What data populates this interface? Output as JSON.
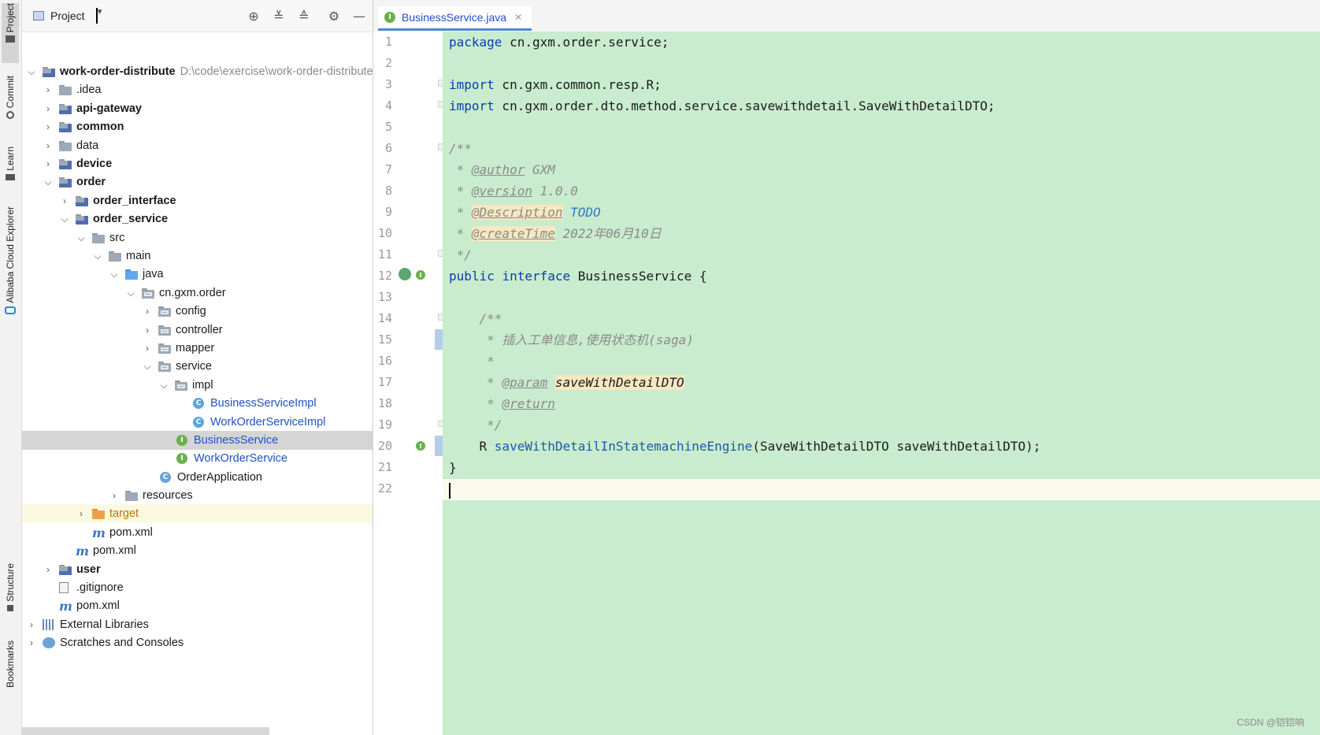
{
  "sidebar": {
    "tabs": [
      {
        "label": "Project",
        "icon": "folder-icon"
      },
      {
        "label": "Commit",
        "icon": "commit-icon"
      },
      {
        "label": "Learn",
        "icon": "learn-icon"
      },
      {
        "label": "Alibaba Cloud Explorer",
        "icon": "cloud-icon"
      },
      {
        "label": "Structure",
        "icon": "structure-icon"
      },
      {
        "label": "Bookmarks",
        "icon": "bookmark-icon"
      }
    ]
  },
  "project": {
    "title": "Project",
    "tools": [
      "locate-icon",
      "expand-all-icon",
      "collapse-all-icon",
      "gear-icon",
      "hide-icon"
    ],
    "tree": [
      {
        "label": "work-order-distribute",
        "path": "D:\\code\\exercise\\work-order-distribute",
        "icon": "module-folder",
        "expanded": true,
        "bold": true
      },
      {
        "label": ".idea",
        "icon": "folder",
        "expanded": false
      },
      {
        "label": "api-gateway",
        "icon": "module-folder",
        "expanded": false,
        "bold": true
      },
      {
        "label": "common",
        "icon": "module-folder",
        "expanded": false,
        "bold": true
      },
      {
        "label": "data",
        "icon": "folder",
        "expanded": false
      },
      {
        "label": "device",
        "icon": "module-folder",
        "expanded": false,
        "bold": true
      },
      {
        "label": "order",
        "icon": "module-folder",
        "expanded": true,
        "bold": true
      },
      {
        "label": "order_interface",
        "icon": "module-folder",
        "expanded": false,
        "bold": true
      },
      {
        "label": "order_service",
        "icon": "module-folder",
        "expanded": true,
        "bold": true
      },
      {
        "label": "src",
        "icon": "folder",
        "expanded": true
      },
      {
        "label": "main",
        "icon": "folder",
        "expanded": true
      },
      {
        "label": "java",
        "icon": "source-folder",
        "expanded": true
      },
      {
        "label": "cn.gxm.order",
        "icon": "package",
        "expanded": true
      },
      {
        "label": "config",
        "icon": "package",
        "expanded": false
      },
      {
        "label": "controller",
        "icon": "package",
        "expanded": false
      },
      {
        "label": "mapper",
        "icon": "package",
        "expanded": false
      },
      {
        "label": "service",
        "icon": "package",
        "expanded": true
      },
      {
        "label": "impl",
        "icon": "package",
        "expanded": true
      },
      {
        "label": "BusinessServiceImpl",
        "icon": "class"
      },
      {
        "label": "WorkOrderServiceImpl",
        "icon": "class"
      },
      {
        "label": "BusinessService",
        "icon": "interface",
        "selected": true
      },
      {
        "label": "WorkOrderService",
        "icon": "interface"
      },
      {
        "label": "OrderApplication",
        "icon": "spring-app"
      },
      {
        "label": "resources",
        "icon": "resources-folder",
        "expanded": false
      },
      {
        "label": "target",
        "icon": "excluded-folder",
        "expanded": false
      },
      {
        "label": "pom.xml",
        "icon": "maven"
      },
      {
        "label": "pom.xml",
        "icon": "maven"
      },
      {
        "label": "user",
        "icon": "module-folder",
        "expanded": false,
        "bold": true
      },
      {
        "label": ".gitignore",
        "icon": "file"
      },
      {
        "label": "pom.xml",
        "icon": "maven"
      },
      {
        "label": "External Libraries",
        "icon": "library",
        "expanded": false
      },
      {
        "label": "Scratches and Consoles",
        "icon": "scratch",
        "expanded": false
      }
    ]
  },
  "editor": {
    "tab": {
      "label": "BusinessService.java",
      "icon": "interface-icon"
    },
    "line_numbers": [
      "1",
      "2",
      "3",
      "4",
      "5",
      "6",
      "7",
      "8",
      "9",
      "10",
      "11",
      "12",
      "13",
      "14",
      "15",
      "16",
      "17",
      "18",
      "19",
      "20",
      "21",
      "22"
    ],
    "code": {
      "l1_kw": "package",
      "l1_rest": " cn.gxm.order.service;",
      "l3_kw": "import",
      "l3_rest": " cn.gxm.common.resp.R;",
      "l4_kw": "import",
      "l4_rest": " cn.gxm.order.dto.method.service.savewithdetail.SaveWithDetailDTO;",
      "l6": "/**",
      "l7_pre": " * ",
      "l7_tag": "@author",
      "l7_val": " GXM",
      "l8_pre": " * ",
      "l8_tag": "@version",
      "l8_val": " 1.0.0",
      "l9_pre": " * ",
      "l9_tag": "@Description",
      "l9_val": " TODO",
      "l10_pre": " * ",
      "l10_tag": "@createTime",
      "l10_val": " 2022年06月10日",
      "l11": " */",
      "l12_kw1": "public",
      "l12_kw2": "interface",
      "l12_rest": " BusinessService {",
      "l14": "    /**",
      "l15": "     * 插入工单信息,使用状态机(saga)",
      "l16": "     *",
      "l17_pre": "     * ",
      "l17_tag": "@param",
      "l17_val": "saveWithDetailDTO",
      "l18_pre": "     * ",
      "l18_tag": "@return",
      "l19": "     */",
      "l20_pre": "    R ",
      "l20_method": "saveWithDetailInStatemachineEngine",
      "l20_rest": "(SaveWithDetailDTO saveWithDetailDTO);",
      "l21": "}"
    }
  },
  "watermark": "CSDN @铠铠响"
}
